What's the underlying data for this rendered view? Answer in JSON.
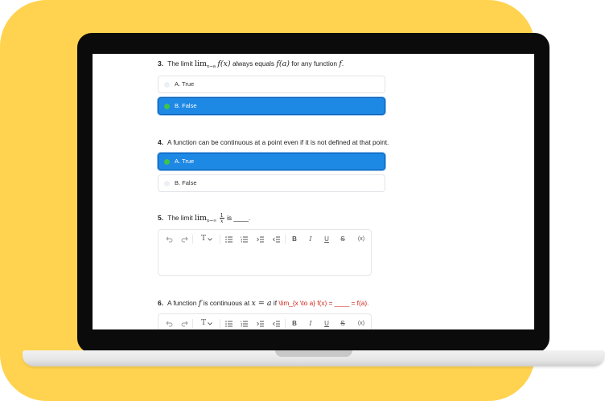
{
  "questions": [
    {
      "number": "3.",
      "text_before": "The limit",
      "math_lim": "lim",
      "math_sub": "x→a",
      "math_fx": "f(x)",
      "text_mid": "always equals",
      "math_fa": "f(a)",
      "text_after": "for any function",
      "math_f": "f",
      "text_end": ".",
      "options": [
        {
          "label": "A. True",
          "selected": false
        },
        {
          "label": "B. False",
          "selected": true
        }
      ]
    },
    {
      "number": "4.",
      "text": "A function can be continuous at a point even if it is not defined at that point.",
      "options": [
        {
          "label": "A. True",
          "selected": true
        },
        {
          "label": "B. False",
          "selected": false
        }
      ]
    },
    {
      "number": "5.",
      "text_before": "The limit",
      "math_lim": "lim",
      "math_sub": "x→∞",
      "frac_num": "1",
      "frac_den": "x",
      "text_after": "is ____."
    },
    {
      "number": "6.",
      "text_before": "A function",
      "math_f": "f",
      "text_mid": "is continuous at",
      "math_eq": "x = a",
      "text_if": "if",
      "latex_raw": "\\lim_{x \\to a} f(x) = ____ = f(a)."
    }
  ],
  "toolbar_icons": [
    "undo-icon",
    "redo-icon",
    "text-size-icon",
    "bullet-list-icon",
    "numbered-list-icon",
    "indent-icon",
    "outdent-icon",
    "bold-icon",
    "italic-icon",
    "underline-icon",
    "strikethrough-icon",
    "formula-icon"
  ],
  "toolbar_glyphs": {
    "text_size": "T",
    "bold": "B",
    "italic": "I",
    "underline": "U",
    "strikethrough": "S",
    "formula": "(x)"
  },
  "colors": {
    "background_yellow": "#ffd34f",
    "selected_blue": "#1e88e5",
    "radio_green": "#3ec44a",
    "latex_red": "#d0271c"
  }
}
